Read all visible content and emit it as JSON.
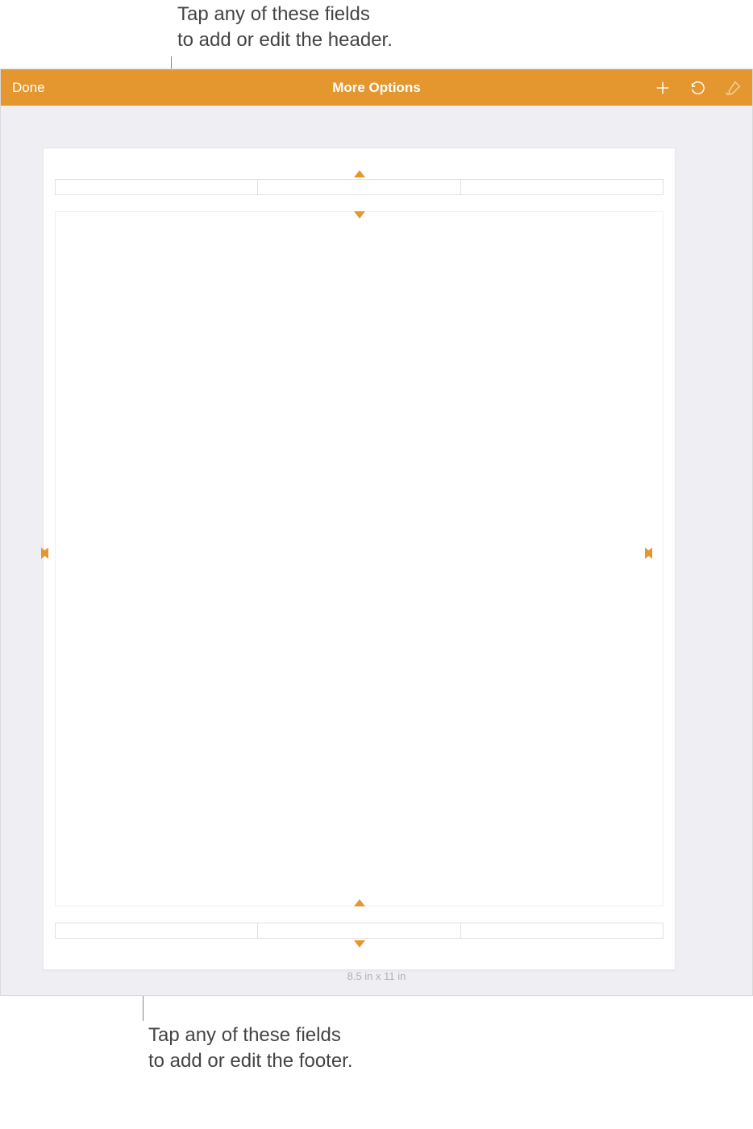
{
  "callouts": {
    "header": "Tap any of these fields\nto add or edit the header.",
    "footer": "Tap any of these fields\nto add or edit the footer."
  },
  "toolbar": {
    "done_label": "Done",
    "title": "More Options"
  },
  "icons": {
    "add": "add-icon",
    "undo": "undo-icon",
    "brush": "brush-icon"
  },
  "page": {
    "dimensions": "8.5 in x 11 in"
  },
  "colors": {
    "accent": "#e4972e"
  }
}
